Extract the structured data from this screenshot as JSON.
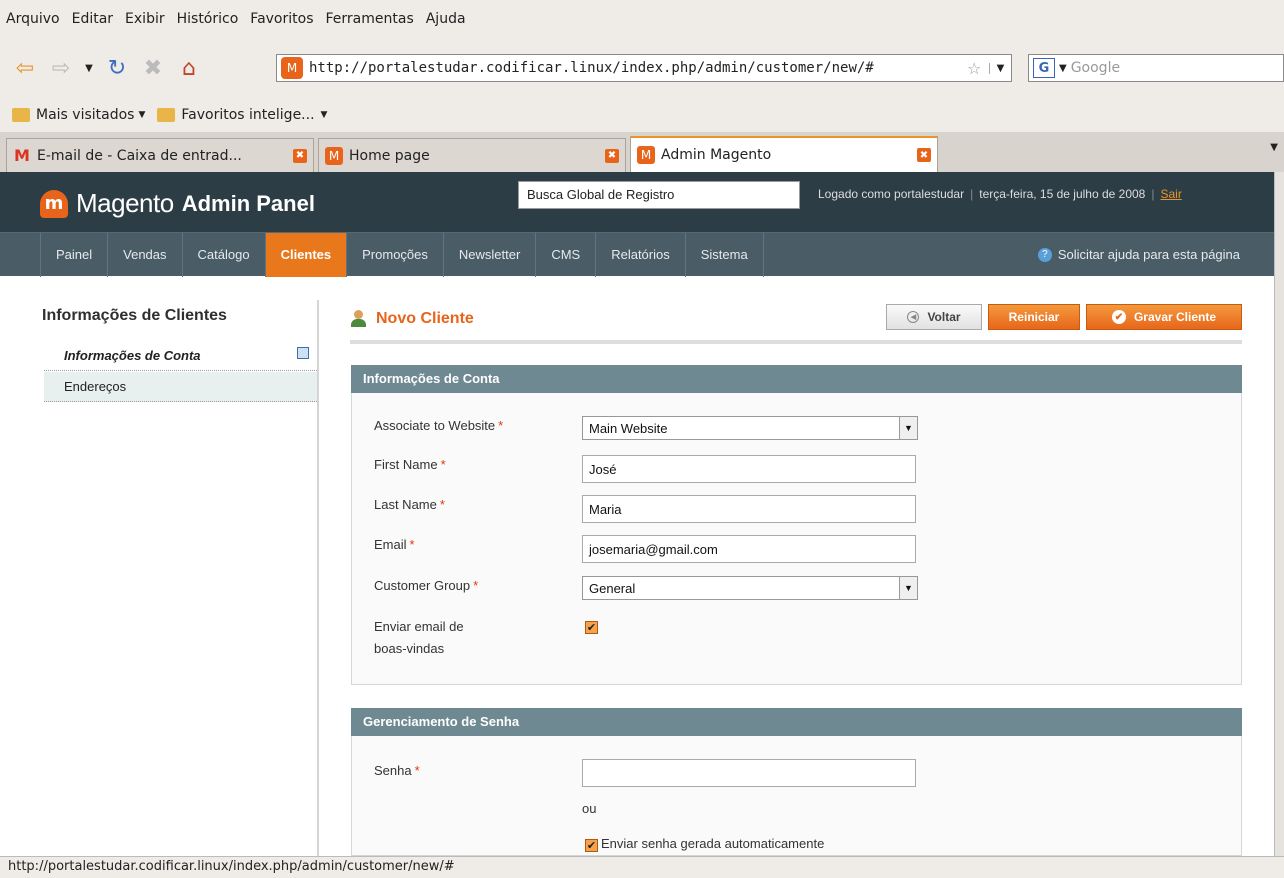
{
  "browser": {
    "menu": [
      "Arquivo",
      "Editar",
      "Exibir",
      "Histórico",
      "Favoritos",
      "Ferramentas",
      "Ajuda"
    ],
    "url": "http://portalestudar.codificar.linux/index.php/admin/customer/new/#",
    "search_placeholder": "Google",
    "bookmarks": [
      "Mais visitados",
      "Favoritos intelige..."
    ],
    "tabs": [
      {
        "label": "E-mail de - Caixa de entrad..."
      },
      {
        "label": "Home page"
      },
      {
        "label": "Admin Magento"
      }
    ],
    "status": "http://portalestudar.codificar.linux/index.php/admin/customer/new/#"
  },
  "header": {
    "logo_word": "Magento",
    "logo_sub": "Admin Panel",
    "global_search": "Busca Global de Registro",
    "logged_as": "Logado como portalestudar",
    "date": "terça-feira, 15 de julho de 2008",
    "logout": "Sair"
  },
  "nav": {
    "items": [
      "Painel",
      "Vendas",
      "Catálogo",
      "Clientes",
      "Promoções",
      "Newsletter",
      "CMS",
      "Relatórios",
      "Sistema"
    ],
    "active": "Clientes",
    "help": "Solicitar ajuda para esta página"
  },
  "sidebar": {
    "title": "Informações de Clientes",
    "items": [
      "Informações de Conta",
      "Endereços"
    ]
  },
  "main": {
    "title": "Novo Cliente",
    "buttons": {
      "back": "Voltar",
      "reset": "Reiniciar",
      "save": "Gravar Cliente"
    },
    "account": {
      "head": "Informações de Conta",
      "website_label": "Associate to Website",
      "website_value": "Main Website",
      "first_label": "First Name",
      "first_value": "José",
      "last_label": "Last Name",
      "last_value": "Maria",
      "email_label": "Email",
      "email_value": "josemaria@gmail.com",
      "group_label": "Customer Group",
      "group_value": "General",
      "welcome_label_1": "Enviar email de",
      "welcome_label_2": "boas-vindas"
    },
    "password": {
      "head": "Gerenciamento de Senha",
      "label": "Senha",
      "or": "ou",
      "auto": "Enviar senha gerada automaticamente"
    }
  },
  "colors": {
    "accent": "#e8641b",
    "header_bg": "#2c3d46",
    "nav_bg": "#4a5c66",
    "fieldset_head": "#6f8992"
  }
}
